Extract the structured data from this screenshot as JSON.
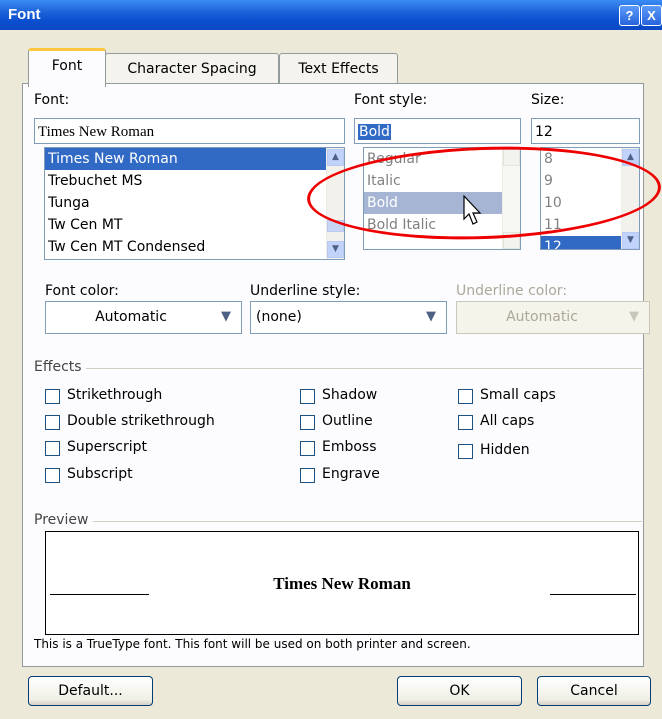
{
  "window": {
    "title": "Font",
    "help": "?",
    "close": "X"
  },
  "tabs": [
    {
      "label": "Font"
    },
    {
      "label": "Character Spacing"
    },
    {
      "label": "Text Effects"
    }
  ],
  "font": {
    "label": "Font:",
    "value": "Times New Roman",
    "items": [
      "Times New Roman",
      "Trebuchet MS",
      "Tunga",
      "Tw Cen MT",
      "Tw Cen MT Condensed"
    ]
  },
  "style": {
    "label": "Font style:",
    "value": "Bold",
    "items": [
      "Regular",
      "Italic",
      "Bold",
      "Bold Italic"
    ]
  },
  "size": {
    "label": "Size:",
    "value": "12",
    "items": [
      "8",
      "9",
      "10",
      "11",
      "12"
    ]
  },
  "font_color": {
    "label": "Font color:",
    "value": "Automatic"
  },
  "underline_style": {
    "label": "Underline style:",
    "value": "(none)"
  },
  "underline_color": {
    "label": "Underline color:",
    "value": "Automatic"
  },
  "effects": {
    "label": "Effects",
    "col1": [
      "Strikethrough",
      "Double strikethrough",
      "Superscript",
      "Subscript"
    ],
    "col2": [
      "Shadow",
      "Outline",
      "Emboss",
      "Engrave"
    ],
    "col3": [
      "Small caps",
      "All caps",
      "Hidden"
    ]
  },
  "preview": {
    "label": "Preview",
    "sample": "Times New Roman",
    "note": "This is a TrueType font. This font will be used on both printer and screen."
  },
  "buttons": {
    "default": "Default...",
    "ok": "OK",
    "cancel": "Cancel"
  },
  "colors": {
    "selection": "#316ac5",
    "annotation": "#ee0000",
    "titlebar": "#0a4fd0"
  }
}
